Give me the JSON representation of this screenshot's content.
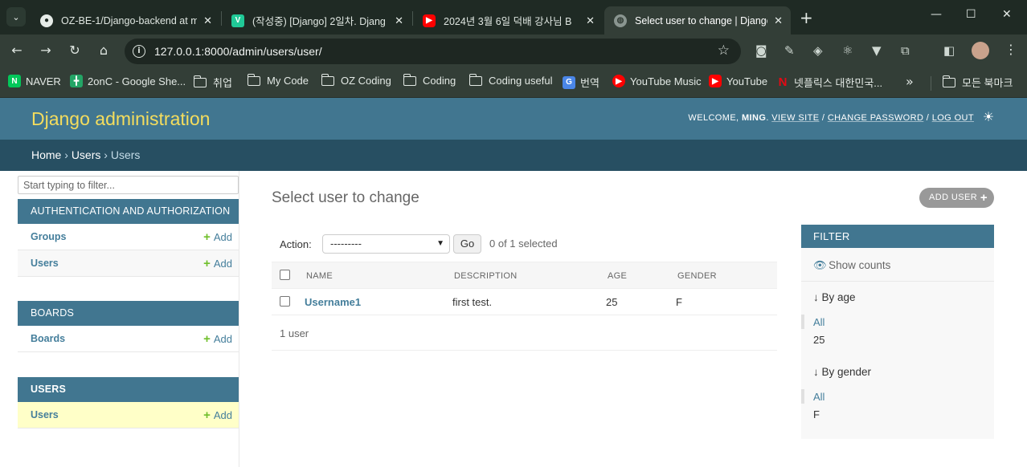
{
  "browser": {
    "tabs": [
      {
        "title": "OZ-BE-1/Django-backend at m",
        "favicon": "github-icon"
      },
      {
        "title": "(작성중) [Django] 2일차. Djang",
        "favicon": "velog-icon"
      },
      {
        "title": "2024년 3월 6일 덕배 강사님 B",
        "favicon": "youtube-icon"
      },
      {
        "title": "Select user to change | Django",
        "favicon": "globe-icon"
      }
    ],
    "url": "127.0.0.1:8000/admin/users/user/",
    "bookmarks": [
      {
        "label": "NAVER",
        "icon": "naver-icon"
      },
      {
        "label": "2onC - Google She...",
        "icon": "sheets-icon"
      },
      {
        "label": "취업",
        "icon": "folder-icon"
      },
      {
        "label": "My Code",
        "icon": "folder-icon"
      },
      {
        "label": "OZ Coding",
        "icon": "folder-icon"
      },
      {
        "label": "Coding",
        "icon": "folder-icon"
      },
      {
        "label": "Coding useful",
        "icon": "folder-icon"
      },
      {
        "label": "번역",
        "icon": "translate-icon"
      },
      {
        "label": "YouTube Music",
        "icon": "youtube-music-icon"
      },
      {
        "label": "YouTube",
        "icon": "youtube-icon"
      },
      {
        "label": "넷플릭스 대한민국...",
        "icon": "netflix-icon"
      }
    ],
    "all_bookmarks": "모든 북마크"
  },
  "header": {
    "brand": "Django administration",
    "welcome": "WELCOME,",
    "user": "MING",
    "view_site": "VIEW SITE",
    "change_password": "CHANGE PASSWORD",
    "log_out": "LOG OUT"
  },
  "breadcrumbs": {
    "home": "Home",
    "app": "Users",
    "current": "Users"
  },
  "sidebar": {
    "filter_placeholder": "Start typing to filter...",
    "apps": [
      {
        "name": "AUTHENTICATION AND AUTHORIZATION",
        "models": [
          {
            "name": "Groups",
            "add": "Add"
          },
          {
            "name": "Users",
            "add": "Add"
          }
        ]
      },
      {
        "name": "BOARDS",
        "models": [
          {
            "name": "Boards",
            "add": "Add"
          }
        ]
      },
      {
        "name": "USERS",
        "models": [
          {
            "name": "Users",
            "add": "Add"
          }
        ]
      }
    ]
  },
  "main": {
    "title": "Select user to change",
    "add_button": "ADD USER",
    "action": {
      "label": "Action:",
      "selected_option": "---------",
      "go": "Go",
      "counter": "0 of 1 selected"
    },
    "table": {
      "columns": [
        "NAME",
        "DESCRIPTION",
        "AGE",
        "GENDER"
      ],
      "rows": [
        {
          "name": "Username1",
          "description": "first test.",
          "age": "25",
          "gender": "F"
        }
      ]
    },
    "paginator": "1 user"
  },
  "filter": {
    "title": "FILTER",
    "show_counts": "Show counts",
    "groups": [
      {
        "title": "↓ By age",
        "choices": [
          "All",
          "25"
        ]
      },
      {
        "title": "↓ By gender",
        "choices": [
          "All",
          "F"
        ]
      }
    ]
  },
  "colors": {
    "header": "#417690",
    "breadcrumbs": "#274f62",
    "brand": "#f5dd5d",
    "link": "#447e9b",
    "add_green": "#70bf2b",
    "current_row": "#ffffc8"
  }
}
